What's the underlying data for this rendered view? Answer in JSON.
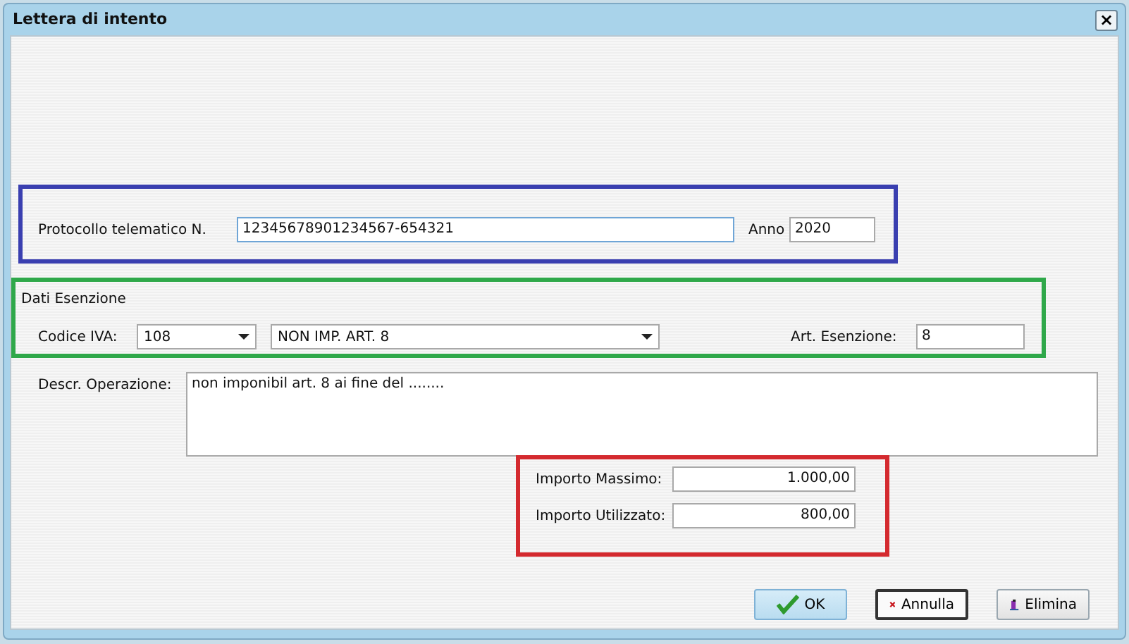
{
  "window": {
    "title": "Lettera di intento",
    "close": "×"
  },
  "protocol": {
    "color": "#3a3fb0",
    "label": "Protocollo telematico N.",
    "value": "12345678901234567-654321",
    "year_label": "Anno",
    "year": "2020"
  },
  "exemption": {
    "color": "#2fa84a",
    "title": "Dati Esenzione",
    "code_label": "Codice IVA:",
    "code": "108",
    "description": "NON IMP. ART. 8",
    "article_label": "Art. Esenzione:",
    "article": "8"
  },
  "operation": {
    "label": "Descr. Operazione:",
    "value": "non imponibil art. 8 ai fine del ........"
  },
  "amounts": {
    "color": "#d42a2f",
    "rows": [
      {
        "label": "Importo Massimo:",
        "value": "1.000,00"
      },
      {
        "label": "Importo Utilizzato:",
        "value": "800,00"
      }
    ]
  },
  "buttons": [
    {
      "kind": "ok",
      "label": "OK"
    },
    {
      "kind": "cancel",
      "label": "Annulla"
    },
    {
      "kind": "delete",
      "label": "Elimina"
    }
  ]
}
